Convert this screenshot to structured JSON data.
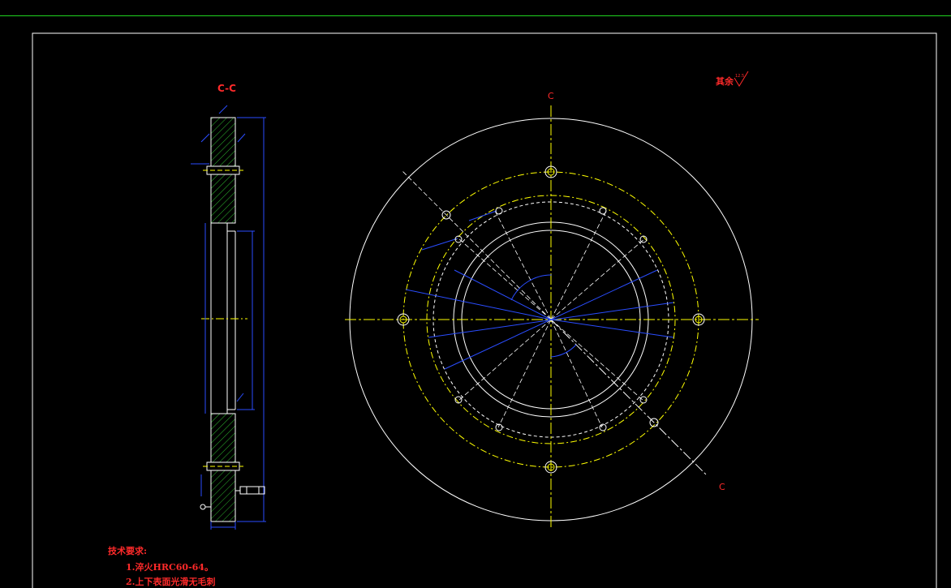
{
  "section_label": "C-C",
  "cut_labels": [
    "C",
    "C"
  ],
  "roughness_note": "其余",
  "roughness_value": "12.5",
  "tech_requirements": {
    "title": "技术要求:",
    "items": [
      "1.淬火HRC60-64。",
      "2.上下表面光滑无毛刺"
    ]
  },
  "colors": {
    "background": "#000000",
    "border": "#ffffff",
    "centerline": "#ffff00",
    "dimension": "#2a4dff",
    "hatch": "#2db52d",
    "text": "#ff2a2a",
    "top_line": "#1fd31f"
  }
}
